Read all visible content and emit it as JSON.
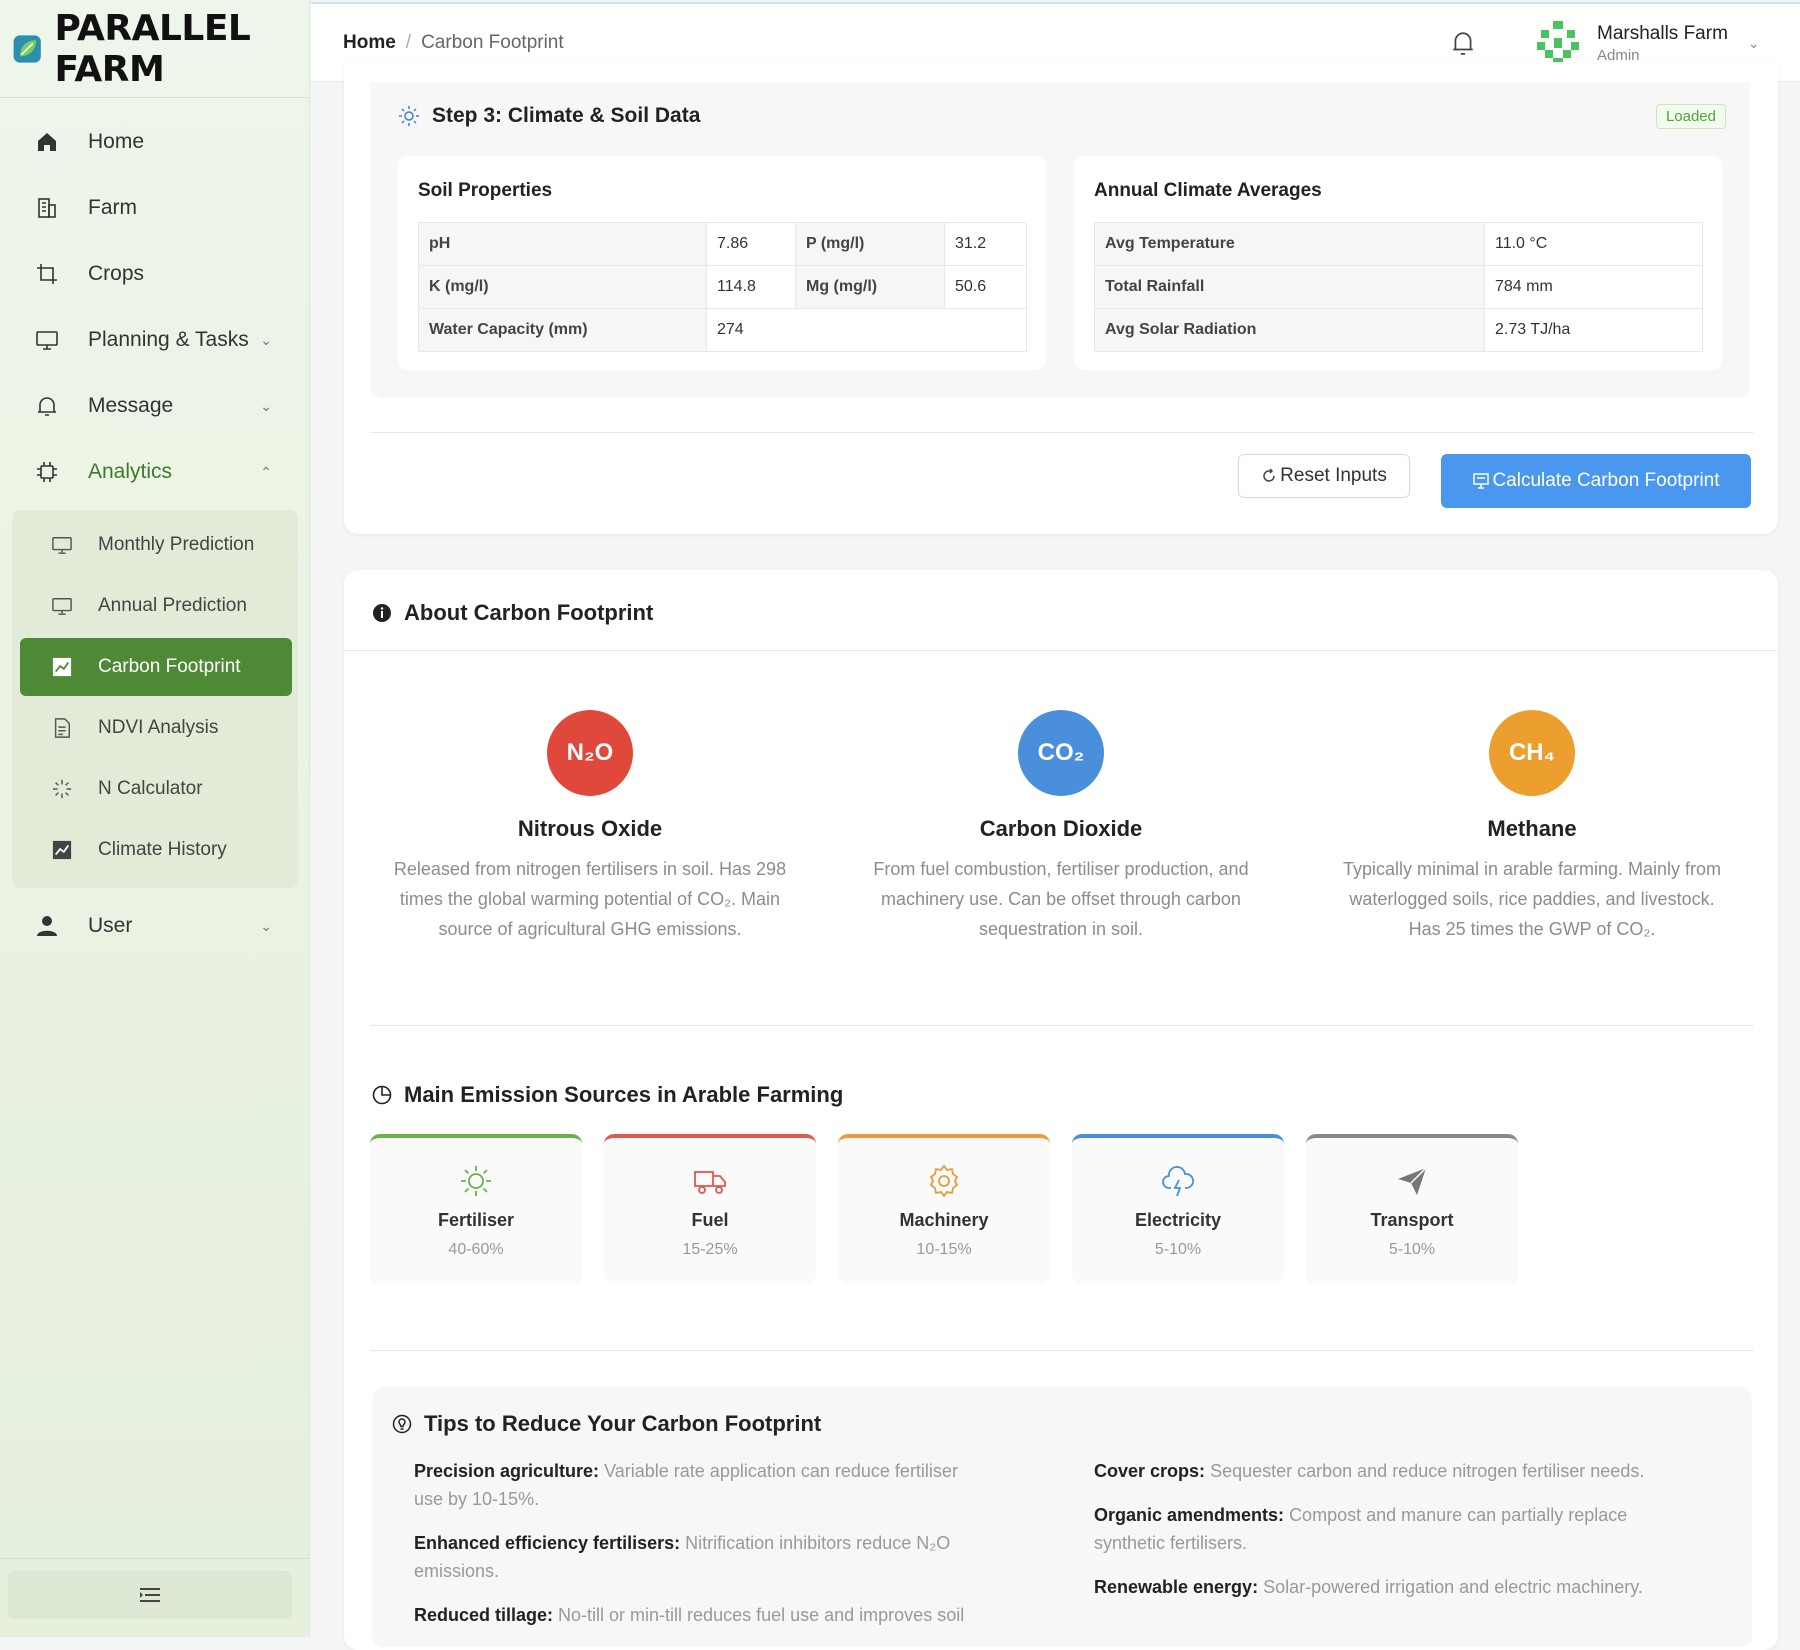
{
  "app": {
    "name": "PARALLEL FARM"
  },
  "sidebar": {
    "items": [
      {
        "label": "Home",
        "icon": "home-icon"
      },
      {
        "label": "Farm",
        "icon": "building-icon"
      },
      {
        "label": "Crops",
        "icon": "crop-icon"
      },
      {
        "label": "Planning & Tasks",
        "icon": "monitor-icon"
      },
      {
        "label": "Message",
        "icon": "bell-icon"
      },
      {
        "label": "Analytics",
        "icon": "chip-icon"
      },
      {
        "label": "User",
        "icon": "user-icon"
      }
    ],
    "analytics_sub": [
      {
        "label": "Monthly Prediction",
        "icon": "monitor-icon"
      },
      {
        "label": "Annual Prediction",
        "icon": "monitor-icon"
      },
      {
        "label": "Carbon Footprint",
        "icon": "chart-icon",
        "active": true
      },
      {
        "label": "NDVI Analysis",
        "icon": "document-icon"
      },
      {
        "label": "N Calculator",
        "icon": "loading-icon"
      },
      {
        "label": "Climate History",
        "icon": "chart-icon"
      }
    ],
    "collapse_icon": "menu-fold-icon"
  },
  "header": {
    "breadcrumb_home": "Home",
    "breadcrumb_sep": "/",
    "breadcrumb_current": "Carbon Footprint",
    "user_name": "Marshalls Farm",
    "user_role": "Admin"
  },
  "step3": {
    "title": "Step 3: Climate & Soil Data",
    "status": "Loaded",
    "soil": {
      "title": "Soil Properties",
      "ph_label": "pH",
      "ph": "7.86",
      "p_label": "P (mg/l)",
      "p": "31.2",
      "k_label": "K (mg/l)",
      "k": "114.8",
      "mg_label": "Mg (mg/l)",
      "mg": "50.6",
      "water_label": "Water Capacity (mm)",
      "water": "274"
    },
    "climate": {
      "title": "Annual Climate Averages",
      "temp_label": "Avg Temperature",
      "temp": "11.0 °C",
      "rain_label": "Total Rainfall",
      "rain": "784 mm",
      "solar_label": "Avg Solar Radiation",
      "solar": "2.73 TJ/ha"
    },
    "reset_label": "Reset Inputs",
    "calc_label": "Calculate Carbon Footprint"
  },
  "about": {
    "title": "About Carbon Footprint",
    "gases": [
      {
        "symbol": "N₂O",
        "name": "Nitrous Oxide",
        "desc": "Released from nitrogen fertilisers in soil. Has 298 times the global warming potential of CO₂. Main source of agricultural GHG emissions.",
        "color": "#e0483c"
      },
      {
        "symbol": "CO₂",
        "name": "Carbon Dioxide",
        "desc": "From fuel combustion, fertiliser production, and machinery use. Can be offset through carbon sequestration in soil.",
        "color": "#4a8fdc"
      },
      {
        "symbol": "CH₄",
        "name": "Methane",
        "desc": "Typically minimal in arable farming. Mainly from waterlogged soils, rice paddies, and livestock. Has 25 times the GWP of CO₂.",
        "color": "#ec9f2e"
      }
    ],
    "sources_title": "Main Emission Sources in Arable Farming",
    "sources": [
      {
        "name": "Fertiliser",
        "pct": "40-60%",
        "color": "#6ab04c",
        "icon": "sun-icon"
      },
      {
        "name": "Fuel",
        "pct": "15-25%",
        "color": "#e0594d",
        "icon": "truck-icon"
      },
      {
        "name": "Machinery",
        "pct": "10-15%",
        "color": "#e99a36",
        "icon": "gear-icon"
      },
      {
        "name": "Electricity",
        "pct": "5-10%",
        "color": "#4a8fdc",
        "icon": "thunder-cloud-icon"
      },
      {
        "name": "Transport",
        "pct": "5-10%",
        "color": "#888888",
        "icon": "send-icon"
      }
    ],
    "tips_title": "Tips to Reduce Your Carbon Footprint",
    "tips": [
      {
        "title": "Precision agriculture:",
        "text": "Variable rate application can reduce fertiliser use by 10-15%."
      },
      {
        "title": "Enhanced efficiency fertilisers:",
        "text": "Nitrification inhibitors reduce N₂O emissions."
      },
      {
        "title": "Reduced tillage:",
        "text": "No-till or min-till reduces fuel use and improves soil"
      },
      {
        "title": "Cover crops:",
        "text": "Sequester carbon and reduce nitrogen fertiliser needs."
      },
      {
        "title": "Organic amendments:",
        "text": "Compost and manure can partially replace synthetic fertilisers."
      },
      {
        "title": "Renewable energy:",
        "text": "Solar-powered irrigation and electric machinery."
      }
    ]
  }
}
